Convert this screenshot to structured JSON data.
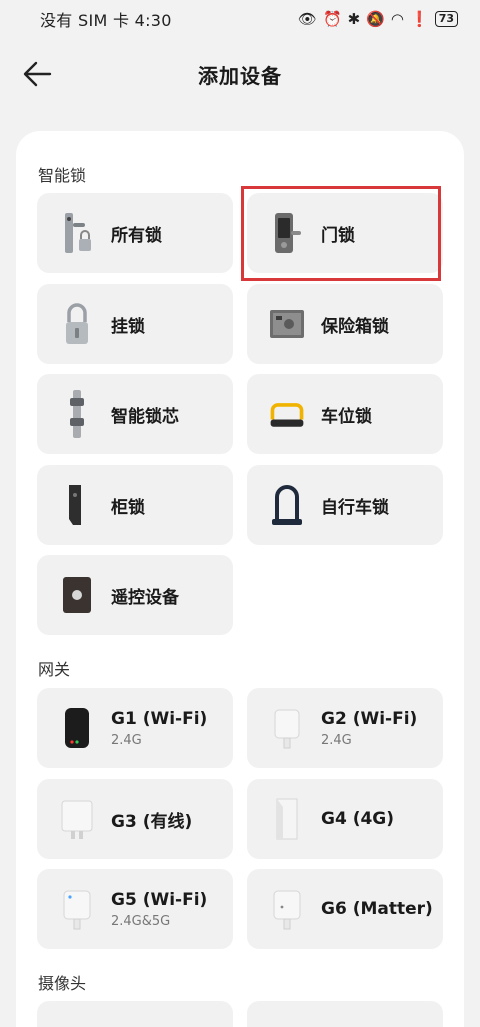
{
  "status_bar": {
    "carrier_time": "没有 SIM 卡 4:30",
    "battery": "73"
  },
  "header": {
    "title": "添加设备"
  },
  "sections": {
    "locks": "智能锁",
    "gateways": "网关",
    "cameras": "摄像头"
  },
  "locks": [
    {
      "label": "所有锁",
      "icon": "door-lock-with-padlock-icon"
    },
    {
      "label": "门锁",
      "icon": "door-lock-icon"
    },
    {
      "label": "挂锁",
      "icon": "padlock-icon"
    },
    {
      "label": "保险箱锁",
      "icon": "safe-icon"
    },
    {
      "label": "智能锁芯",
      "icon": "lock-cylinder-icon"
    },
    {
      "label": "车位锁",
      "icon": "parking-lock-icon"
    },
    {
      "label": "柜锁",
      "icon": "cabinet-lock-icon"
    },
    {
      "label": "自行车锁",
      "icon": "bike-lock-icon"
    },
    {
      "label": "遥控设备",
      "icon": "remote-control-icon"
    }
  ],
  "gateways": [
    {
      "label": "G1 (Wi-Fi)",
      "sub": "2.4G",
      "icon": "gateway-g1-icon"
    },
    {
      "label": "G2 (Wi-Fi)",
      "sub": "2.4G",
      "icon": "gateway-g2-icon"
    },
    {
      "label": "G3 (有线)",
      "sub": "",
      "icon": "gateway-g3-icon"
    },
    {
      "label": "G4 (4G)",
      "sub": "",
      "icon": "gateway-g4-icon"
    },
    {
      "label": "G5 (Wi-Fi)",
      "sub": "2.4G&5G",
      "icon": "gateway-g5-icon"
    },
    {
      "label": "G6 (Matter)",
      "sub": "",
      "icon": "gateway-g6-icon"
    }
  ],
  "highlight_color": "#d9383a"
}
